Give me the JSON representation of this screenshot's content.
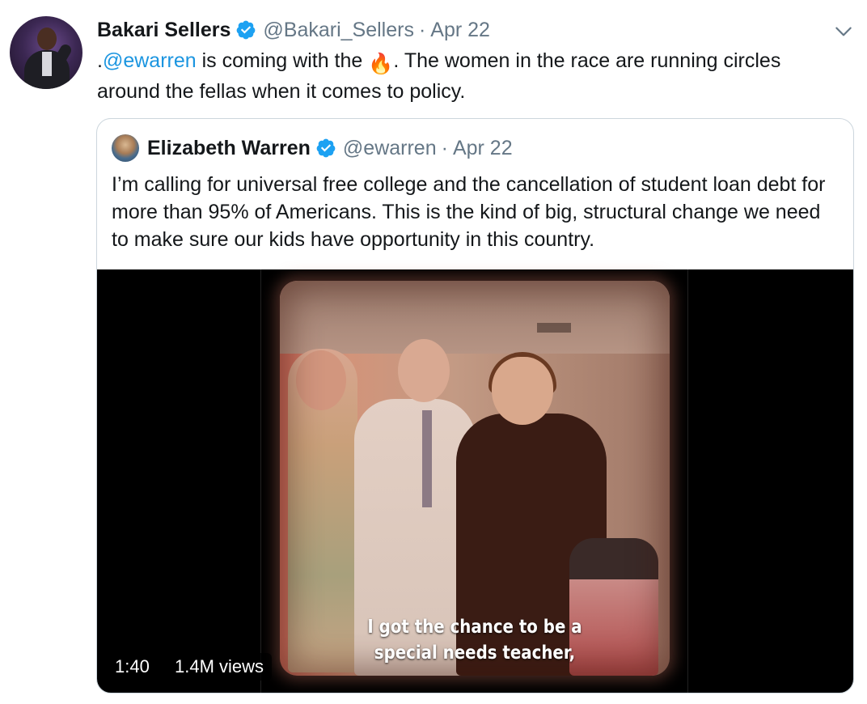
{
  "tweet": {
    "author_name": "Bakari Sellers",
    "author_handle": "@Bakari_Sellers",
    "separator": "·",
    "date": "Apr 22",
    "text_prefix": ".",
    "mention": "@ewarren",
    "text_before_emoji": " is coming with the ",
    "emoji": "🔥",
    "text_after_emoji": ". The women in the race are running circles around the fellas when it comes to policy."
  },
  "quoted_tweet": {
    "author_name": "Elizabeth Warren",
    "author_handle": "@ewarren",
    "separator": "·",
    "date": "Apr 22",
    "text": "I’m calling for universal free college and the cancellation of student loan debt for more than 95% of Americans. This is the kind of big, structural change we need to make sure our kids have opportunity in this country.",
    "video": {
      "caption_line1": "I got the chance to be a",
      "caption_line2": "special needs teacher,",
      "duration": "1:40",
      "views": "1.4M views"
    }
  },
  "icons": {
    "verified": "verified-badge-icon",
    "menu": "chevron-down-icon"
  },
  "colors": {
    "text": "#14171a",
    "secondary": "#657786",
    "link": "#1b95e0",
    "verified": "#1da1f2",
    "border": "#ccd6dd"
  }
}
